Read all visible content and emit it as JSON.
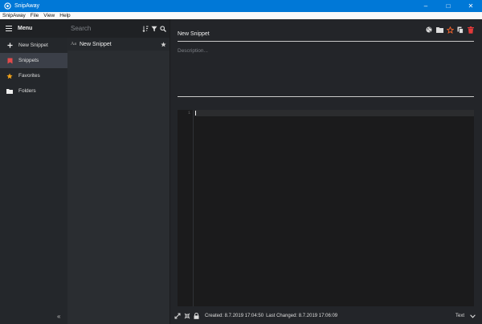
{
  "window": {
    "title": "SnipAway"
  },
  "menubar": [
    "SnipAway",
    "File",
    "View",
    "Help"
  ],
  "nav": {
    "header_label": "Menu",
    "items": [
      {
        "label": "New Snippet",
        "icon": "plus-icon"
      },
      {
        "label": "Snippets",
        "icon": "bookmark-icon",
        "color": "#e24a4a"
      },
      {
        "label": "Favorites",
        "icon": "star-icon",
        "color": "#f0a21a"
      },
      {
        "label": "Folders",
        "icon": "folder-icon"
      }
    ],
    "collapse_glyph": "«"
  },
  "list": {
    "search_placeholder": "Search",
    "snippets": [
      {
        "type": "Aa",
        "name": "New Snippet"
      }
    ]
  },
  "editor": {
    "title": "New Snippet",
    "description_placeholder": "Description...",
    "line_numbers": [
      "1"
    ],
    "status": {
      "created": "Created: 8.7.2019 17:04:50",
      "changed": "Last Changed: 8.7.2019 17:06:09",
      "language": "Text"
    },
    "colors": {
      "favorite": "#e8602c",
      "delete": "#e23a3a"
    }
  }
}
